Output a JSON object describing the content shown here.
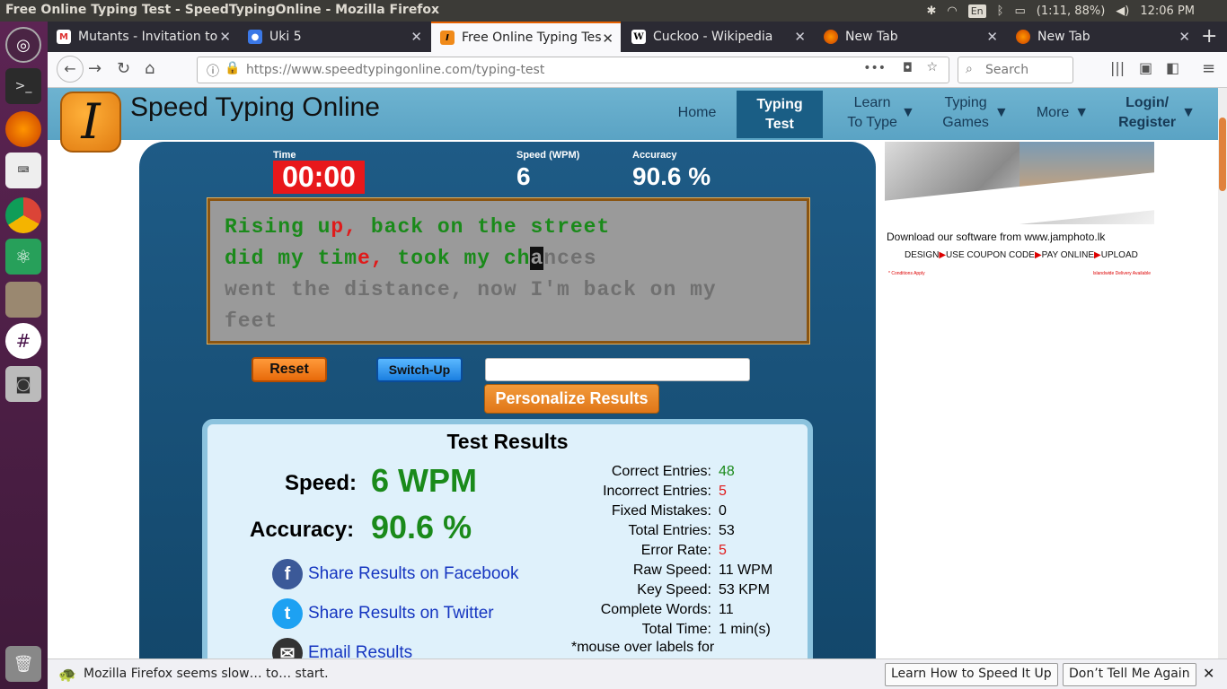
{
  "os": {
    "window_title": "Free Online Typing Test - SpeedTypingOnline - Mozilla Firefox",
    "keyboard_lang": "En",
    "battery": "(1:11, 88%)",
    "clock": "12:06 PM"
  },
  "browser": {
    "tabs": [
      {
        "label": "Mutants - Invitation to",
        "icon": "gmail-icon"
      },
      {
        "label": "Uki 5",
        "icon": "contacts-icon"
      },
      {
        "label": "Free Online Typing Tes",
        "icon": "speedtyping-icon",
        "active": true
      },
      {
        "label": "Cuckoo - Wikipedia",
        "icon": "wikipedia-icon"
      },
      {
        "label": "New Tab",
        "icon": "firefox-icon"
      },
      {
        "label": "New Tab",
        "icon": "firefox-icon"
      }
    ],
    "url_host": "https://www.speedtypingonline.com",
    "url_path": "/typing-test",
    "search_placeholder": "Search"
  },
  "site": {
    "name": "Speed Typing Online",
    "logo_letter": "I",
    "menu": {
      "home": "Home",
      "typing_test_1": "Typing",
      "typing_test_2": "Test",
      "learn_1": "Learn",
      "learn_2": "To Type",
      "games_1": "Typing",
      "games_2": "Games",
      "more": "More",
      "login_1": "Login/",
      "login_2": "Register"
    }
  },
  "test": {
    "time_label": "Time",
    "time_value": "00:00",
    "speed_label": "Speed (WPM)",
    "speed_value": "6",
    "accuracy_label": "Accuracy",
    "accuracy_value": "90.6 %",
    "text": {
      "l1_ok1": "Rising u",
      "l1_bad": "p,",
      "l1_ok2": " back on the street",
      "l2_ok1": "did my tim",
      "l2_bad": "e,",
      "l2_ok2": " took my ch",
      "l2_cur": "a",
      "l2_rest": "nces",
      "l3": "went the distance, now I'm back on my",
      "l4": "feet"
    },
    "reset_label": "Reset",
    "switch_label": "Switch-Up",
    "name_input_value": "",
    "personalize_label": "Personalize Results"
  },
  "results": {
    "title": "Test Results",
    "speed_label": "Speed:",
    "speed_value": "6 WPM",
    "accuracy_label": "Accuracy:",
    "accuracy_value": "90.6 %",
    "share_facebook": "Share Results on Facebook",
    "share_twitter": "Share Results on Twitter",
    "share_email": "Email Results",
    "stats": [
      {
        "label": "Correct Entries:",
        "value": "48",
        "color": "#1a8a1a"
      },
      {
        "label": "Incorrect Entries:",
        "value": "5",
        "color": "#e01a1a"
      },
      {
        "label": "Fixed Mistakes:",
        "value": "0",
        "color": "#000000"
      },
      {
        "label": "Total Entries:",
        "value": "53",
        "color": "#000000"
      },
      {
        "label": "Error Rate:",
        "value": "5",
        "color": "#e01a1a"
      },
      {
        "label": "Raw Speed:",
        "value": "11 WPM",
        "color": "#000000"
      },
      {
        "label": "Key Speed:",
        "value": "53 KPM",
        "color": "#000000"
      },
      {
        "label": "Complete Words:",
        "value": "11",
        "color": "#000000"
      },
      {
        "label": "Total Time:",
        "value": "1 min(s)",
        "color": "#000000"
      }
    ],
    "hint": "*mouse over labels for"
  },
  "ad": {
    "line1": "Download our software from www.jamphoto.lk",
    "line2_a": "DESIGN",
    "line2_b": "USE COUPON CODE",
    "line2_c": "PAY ONLINE",
    "line2_d": "UPLOAD",
    "fine_left": "* Conditions Apply",
    "fine_right": "Islandwide Delivery Available"
  },
  "notification": {
    "message": "Mozilla Firefox seems slow… to… start.",
    "learn_button": "Learn How to Speed It Up",
    "dismiss_button": "Don’t Tell Me Again"
  },
  "colors": {
    "accent_orange": "#e66000",
    "site_header": "#5aa3c4",
    "panel_blue": "#13476b",
    "good_green": "#1a8a1a",
    "bad_red": "#e01a1a"
  }
}
